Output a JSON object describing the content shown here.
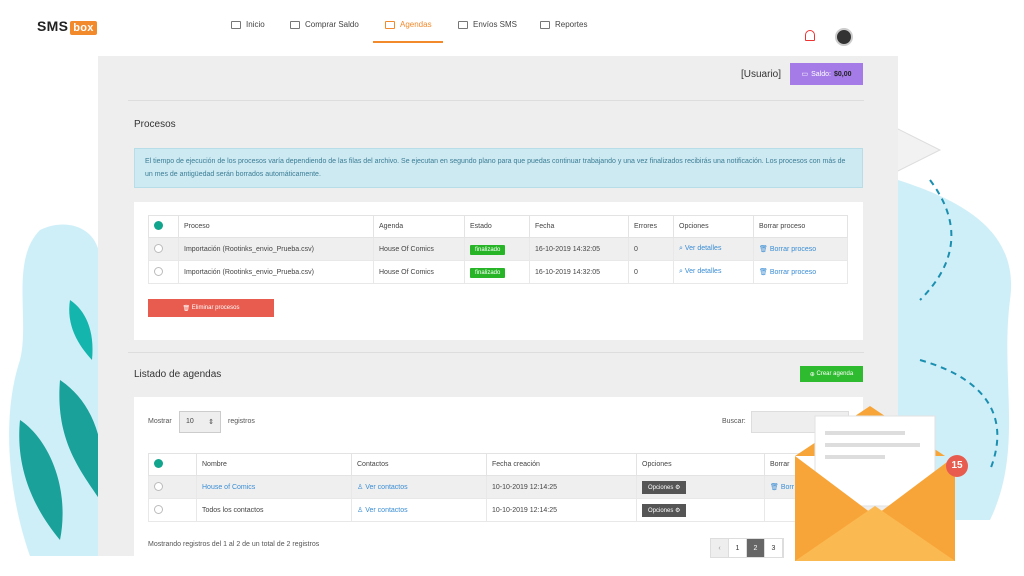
{
  "brand": {
    "name": "SMS",
    "box": "box"
  },
  "nav": {
    "items": [
      {
        "label": "Inicio"
      },
      {
        "label": "Comprar Saldo"
      },
      {
        "label": "Agendas"
      },
      {
        "label": "Envíos SMS"
      },
      {
        "label": "Reportes"
      }
    ],
    "active": "Agendas"
  },
  "account": {
    "user": "[Usuario]",
    "balance_label": "Saldo:",
    "balance_value": "$0,00"
  },
  "procesos": {
    "title": "Procesos",
    "info": "El tiempo de ejecución de los procesos varía dependiendo de las filas del archivo. Se ejecutan en segundo plano para que puedas continuar trabajando y una vez finalizados recibirás una notificación. Los procesos con más de un mes de antigüedad serán borrados automáticamente.",
    "columns": [
      "Proceso",
      "Agenda",
      "Estado",
      "Fecha",
      "Errores",
      "Opciones",
      "Borrar proceso"
    ],
    "rows": [
      {
        "proceso": "Importación (Rootinks_envio_Prueba.csv)",
        "agenda": "House Of Comics",
        "estado": "finalizado",
        "fecha": "16-10-2019 14:32:05",
        "errores": "0",
        "opciones": "Ver detalles",
        "borrar": "Borrar proceso"
      },
      {
        "proceso": "Importación (Rootinks_envio_Prueba.csv)",
        "agenda": "House Of Comics",
        "estado": "finalizado",
        "fecha": "16-10-2019 14:32:05",
        "errores": "0",
        "opciones": "Ver detalles",
        "borrar": "Borrar proceso"
      }
    ],
    "delete_button": "Eliminar procesos"
  },
  "agendas": {
    "title": "Listado de agendas",
    "create_button": "Crear agenda",
    "show_label": "Mostrar",
    "show_value": "10",
    "records_label": "registros",
    "search_label": "Buscar:",
    "columns": [
      "Nombre",
      "Contactos",
      "Fecha creación",
      "Opciones",
      "Borrar"
    ],
    "rows": [
      {
        "nombre": "House of Comics",
        "contactos": "Ver contactos",
        "fecha": "10-10-2019 12:14:25",
        "opciones": "Opciones",
        "borrar": "Borr"
      },
      {
        "nombre": "Todos los contactos",
        "contactos": "Ver contactos",
        "fecha": "10-10-2019 12:14:25",
        "opciones": "Opciones",
        "borrar": ""
      }
    ],
    "footer": "Mostrando registros del 1 al 2 de un total de 2 registros",
    "pages": [
      "1",
      "2",
      "3"
    ],
    "current_page": "2"
  },
  "notification": {
    "count": "15"
  },
  "colors": {
    "accent": "#f28a2c",
    "purple": "#a57be8",
    "green": "#2fbb2f",
    "red": "#e85c4f",
    "teal": "#12a58d"
  }
}
